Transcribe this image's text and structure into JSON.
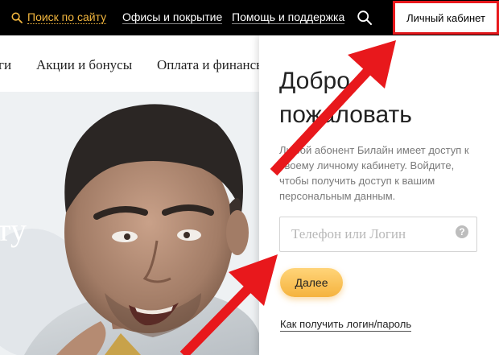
{
  "topbar": {
    "search_link": "Поиск по сайту",
    "offices_link": "Офисы и покрытие",
    "help_link": "Помощь и поддержка",
    "cabinet_button": "Личный кабинет"
  },
  "subnav": {
    "items": [
      "ги",
      "Акции и бонусы",
      "Оплата и финансы"
    ]
  },
  "hero": {
    "partial_text": "ту"
  },
  "login_panel": {
    "title": "Добро пожаловать",
    "description": "Любой абонент Билайн имеет доступ к своему личному кабинету. Войдите, чтобы получить доступ к вашим персональным данным.",
    "login_input": {
      "value": "",
      "placeholder": "Телефон или Логин"
    },
    "help_icon_glyph": "?",
    "submit_button": "Далее",
    "recover_link": "Как получить логин/пароль"
  },
  "colors": {
    "accent": "#f2b63e",
    "topbar_bg": "#000000",
    "highlight_red": "#e8181c",
    "button_yellow": "#f5b33e"
  },
  "icons": {
    "search": "search-icon",
    "help": "help-icon",
    "annotation": "arrow-icon"
  }
}
